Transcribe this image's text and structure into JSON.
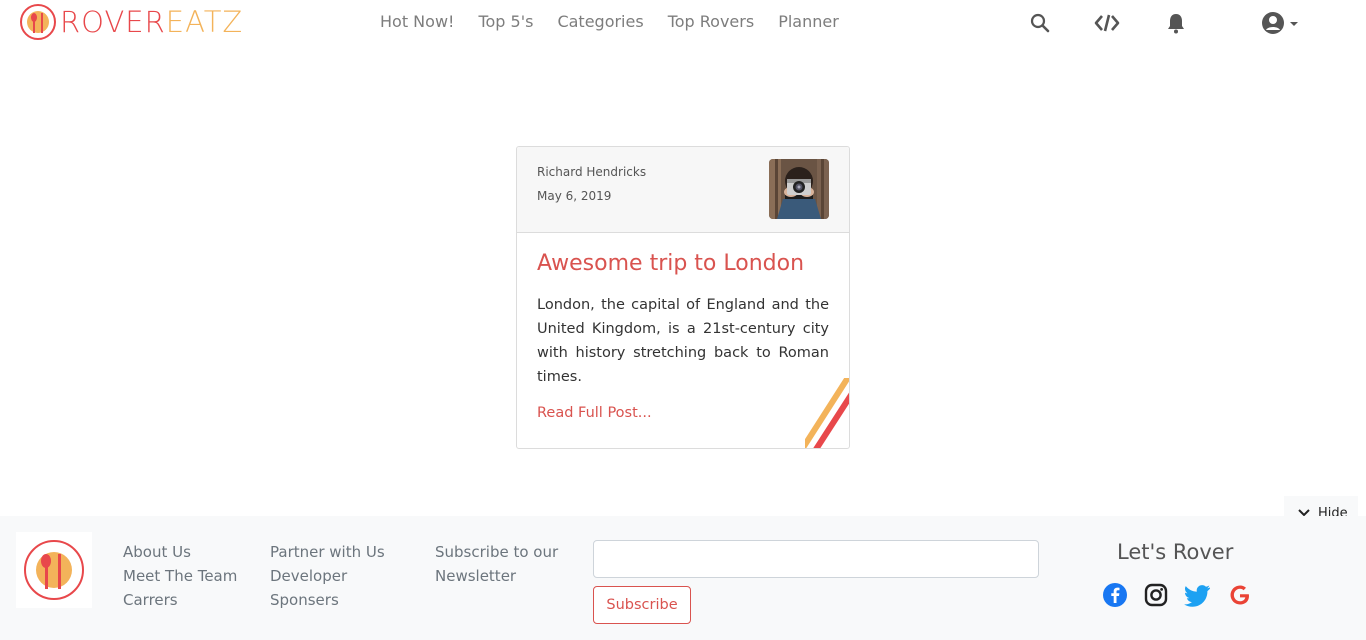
{
  "brand": {
    "name_part1": "ROVER",
    "name_part2": "EATZ"
  },
  "nav": {
    "items": [
      {
        "label": "Hot Now!"
      },
      {
        "label": "Top 5's"
      },
      {
        "label": "Categories"
      },
      {
        "label": "Top Rovers"
      },
      {
        "label": "Planner"
      }
    ]
  },
  "header_icons": [
    "search-icon",
    "code-icon",
    "bell-icon",
    "account-icon",
    "caret-down-icon"
  ],
  "post": {
    "author": "Richard Hendricks",
    "date": "May 6, 2019",
    "title": "Awesome trip to London",
    "body": "London, the capital of England and the United Kingdom, is a 21st-century city with history stretching back to Roman times.",
    "read_more": "Read Full Post..."
  },
  "hide_toggle": {
    "label": "Hide"
  },
  "footer": {
    "col1": [
      "About Us",
      "Meet The Team",
      "Carrers"
    ],
    "col2": [
      "Partner with Us",
      "Developer",
      "Sponsers"
    ],
    "subscribe_text_line1": "Subscribe to our",
    "subscribe_text_line2": "Newsletter",
    "email_value": "",
    "subscribe_label": "Subscribe",
    "tagline": "Let's Rover",
    "social": [
      "facebook-icon",
      "instagram-icon",
      "twitter-icon",
      "google-icon"
    ]
  },
  "colors": {
    "accent_red": "#d9534f",
    "accent_orange": "#f3b35a",
    "nav_gray": "#7d7d7d",
    "facebook": "#1877f2",
    "twitter": "#1da1f2",
    "google": "#ea4335"
  }
}
